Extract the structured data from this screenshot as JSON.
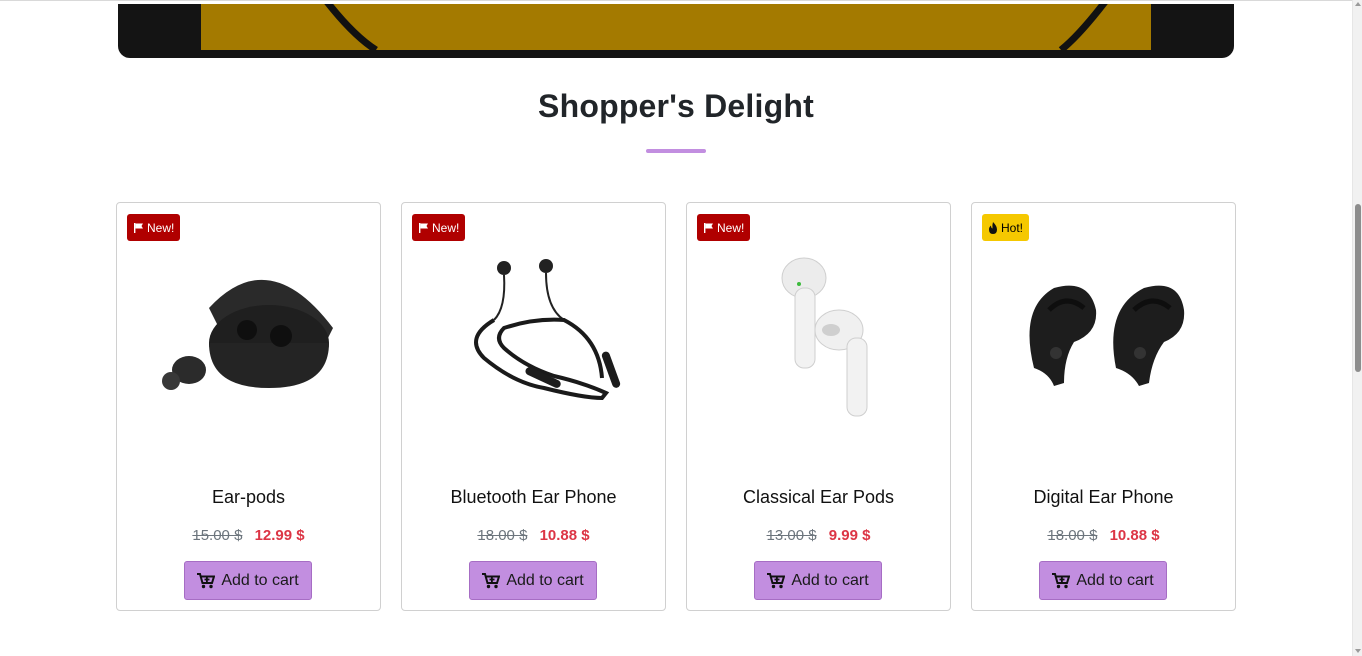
{
  "section": {
    "title": "Shopper's Delight",
    "accent_color": "#c28ee0"
  },
  "products": [
    {
      "badge": "New!",
      "badge_icon": "flag-icon",
      "badge_color": "#b00000",
      "name": "Ear-pods",
      "old_price": "15.00 $",
      "new_price": "12.99 $",
      "button": "Add to cart"
    },
    {
      "badge": "New!",
      "badge_icon": "flag-icon",
      "badge_color": "#b00000",
      "name": "Bluetooth Ear Phone",
      "old_price": "18.00 $",
      "new_price": "10.88 $",
      "button": "Add to cart"
    },
    {
      "badge": "New!",
      "badge_icon": "flag-icon",
      "badge_color": "#b00000",
      "name": "Classical Ear Pods",
      "old_price": "13.00 $",
      "new_price": "9.99 $",
      "button": "Add to cart"
    },
    {
      "badge": "Hot!",
      "badge_icon": "fire-icon",
      "badge_color": "#f5c800",
      "name": "Digital Ear Phone",
      "old_price": "18.00 $",
      "new_price": "10.88 $",
      "button": "Add to cart"
    }
  ],
  "icons": {
    "cart": "cart-icon"
  },
  "colors": {
    "new_price": "#dc3545",
    "button_bg": "#c28ee0"
  }
}
